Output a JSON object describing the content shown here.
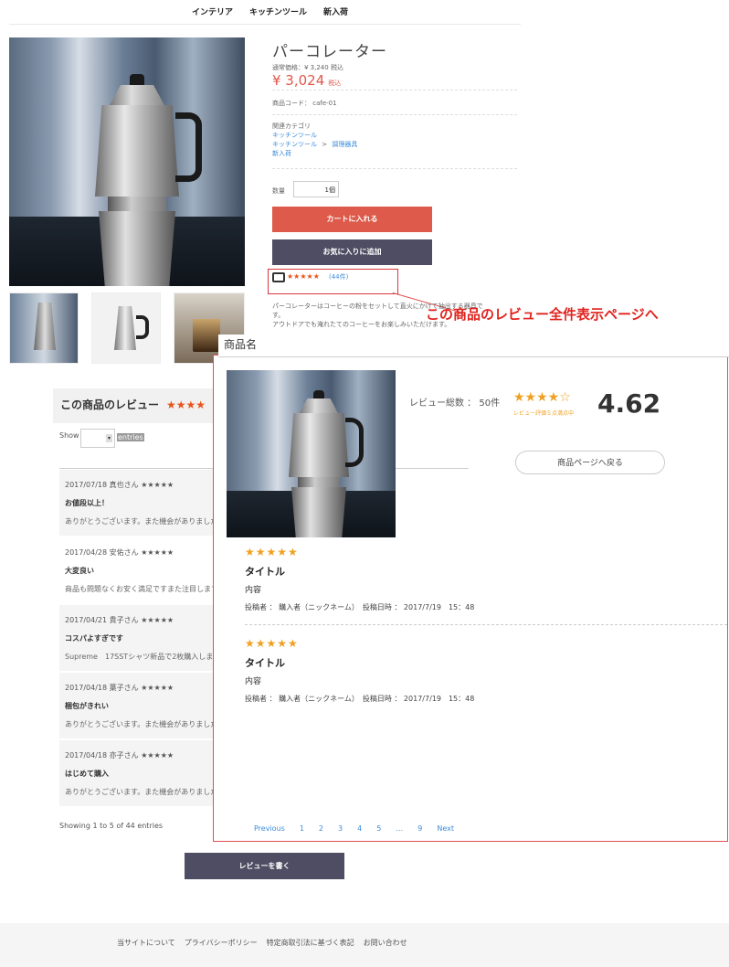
{
  "nav": [
    "インテリア",
    "キッチンツール",
    "新入荷"
  ],
  "product": {
    "title": "パーコレーター",
    "list_price": "通常価格：¥ 3,240 税込",
    "price": "¥ 3,024",
    "price_tax": "税込",
    "code": "商品コード： cafe-01",
    "category_label": "関連カテゴリ",
    "categories": [
      "キッチンツール",
      "キッチンツール",
      "調理器具",
      "新入荷"
    ],
    "category_sep": ">",
    "qty_label": "数量",
    "qty_value": "1個",
    "cart_button": "カートに入れる",
    "fav_button": "お気に入りに追加",
    "rating_stars": "★★★★★",
    "rating_count": "(44件)",
    "desc": [
      "パーコレーターはコーヒーの粉をセットして直火にかけて抽出する器具で",
      "す。",
      "アウトドアでも淹れたてのコーヒーをお楽しみいただけます。"
    ]
  },
  "callout": "この商品のレビュー全件表示ページへ",
  "reviews_section": {
    "title": "この商品のレビュー",
    "stars": "★★★★",
    "show_label": "Show",
    "entries_label": "entries",
    "items": [
      {
        "date": "2017/07/18 真也さん ★★★★★",
        "title": "お値段以上！",
        "body": "ありがとうございます。また機会がありましたら"
      },
      {
        "date": "2017/04/28 安佑さん ★★★★★",
        "title": "大変良い",
        "body": "商品も問題なくお安く満足ですまた注目します"
      },
      {
        "date": "2017/04/21 貴子さん ★★★★★",
        "title": "コスパよすぎです",
        "body": "Supreme　17SSTシャツ新品で2枚購入しました。値"
      },
      {
        "date": "2017/04/18 葉子さん ★★★★★",
        "title": "梱包がきれい",
        "body": "ありがとうございます。また機会がありましたら宜しくお願い致します。"
      },
      {
        "date": "2017/04/18 亦子さん ★★★★★",
        "title": "はじめて購入",
        "body": "ありがとうございます。また機会がありましたら宜しくお願い致します。"
      }
    ],
    "showing": "Showing 1 to 5 of 44 entries",
    "write_button": "レビューを書く"
  },
  "overlay": {
    "header": "商品名",
    "total": "レビュー総数 ： 50件",
    "stars": "★★★★☆",
    "sub": "レビュー評価５点満点中",
    "score": "4.62",
    "back_button": "商品ページへ戻る",
    "reviews": [
      {
        "stars": "★★★★★",
        "title": "タイトル",
        "content": "内容",
        "meta": "投稿者 ： 購入者（ニックネーム）　投稿日時 ： 2017/7/19　15：48"
      },
      {
        "stars": "★★★★★",
        "title": "タイトル",
        "content": "内容",
        "meta": "投稿者 ： 購入者（ニックネーム）　投稿日時 ： 2017/7/19　15：48"
      }
    ],
    "pager": [
      "Previous",
      "1",
      "2",
      "3",
      "4",
      "5",
      "…",
      "9",
      "Next"
    ]
  },
  "footer": [
    "当サイトについて",
    "プライバシーポリシー",
    "特定商取引法に基づく表記",
    "お問い合わせ"
  ]
}
